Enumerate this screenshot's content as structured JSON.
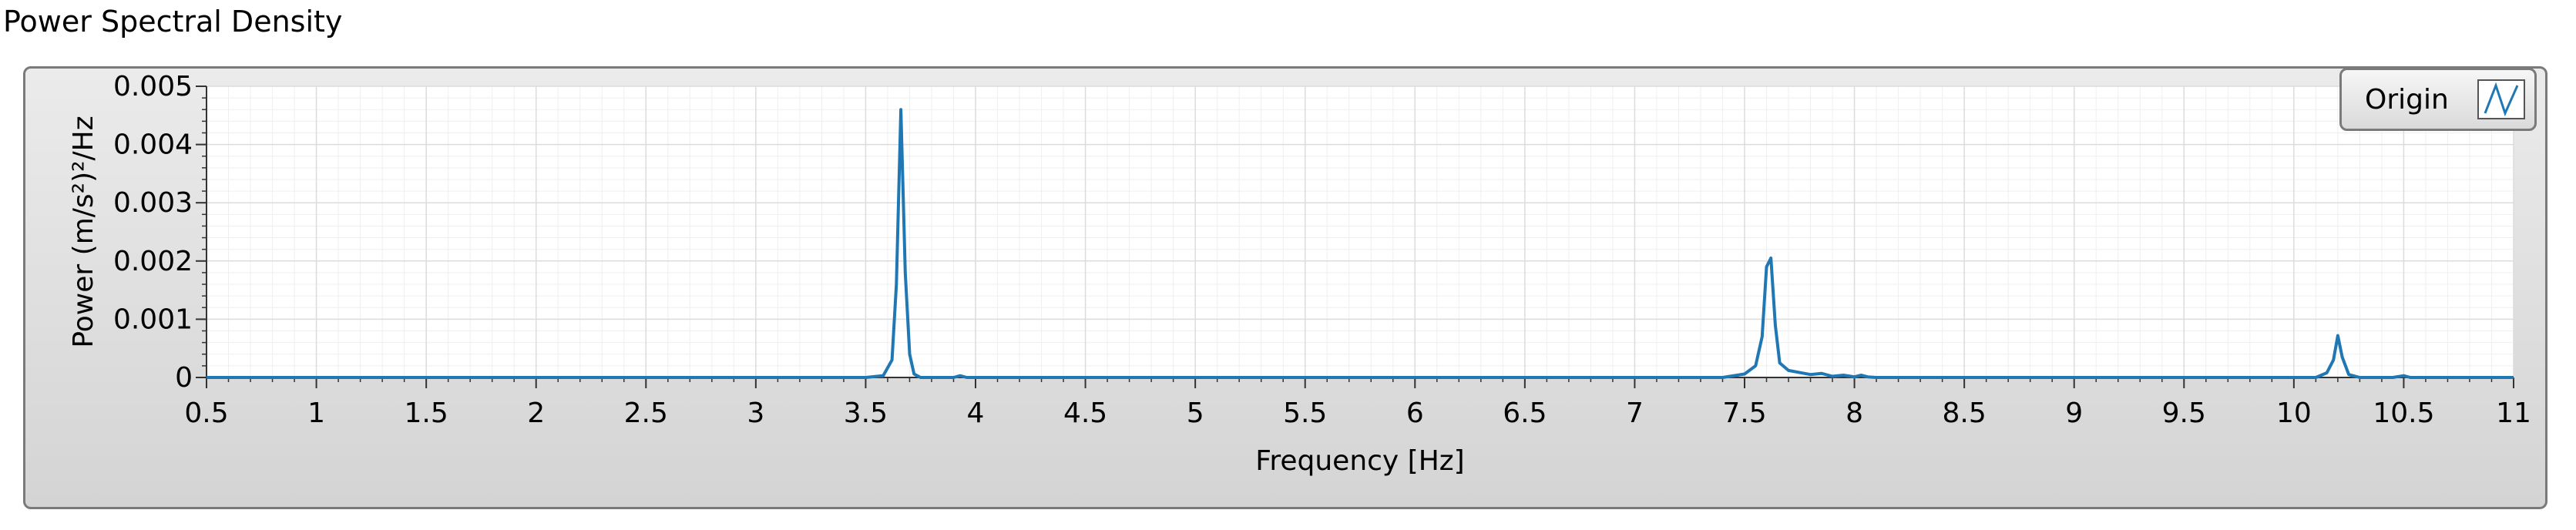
{
  "window": {
    "title": "Power Spectral Density"
  },
  "legend": {
    "entries": [
      {
        "label": "Origin",
        "color": "#1f77b4"
      }
    ]
  },
  "colors": {
    "line": "#1f77b4",
    "plot_background": "#ffffff",
    "grid_major": "#dcdcdc",
    "grid_minor": "#efefef",
    "frame": "#d9d9d9"
  },
  "chart_data": {
    "type": "line",
    "title": "",
    "xlabel": "Frequency [Hz]",
    "ylabel": "Power (m/s²)²/Hz",
    "xlim": [
      0.5,
      11
    ],
    "ylim": [
      0,
      0.005
    ],
    "xticks": [
      0.5,
      1,
      1.5,
      2,
      2.5,
      3,
      3.5,
      4,
      4.5,
      5,
      5.5,
      6,
      6.5,
      7,
      7.5,
      8,
      8.5,
      9,
      9.5,
      10,
      10.5,
      11
    ],
    "xtick_labels": [
      "0.5",
      "1",
      "1.5",
      "2",
      "2.5",
      "3",
      "3.5",
      "4",
      "4.5",
      "5",
      "5.5",
      "6",
      "6.5",
      "7",
      "7.5",
      "8",
      "8.5",
      "9",
      "9.5",
      "10",
      "10.5",
      "11"
    ],
    "yticks": [
      0,
      0.001,
      0.002,
      0.003,
      0.004,
      0.005
    ],
    "ytick_labels": [
      "0",
      "0.001",
      "0.002",
      "0.003",
      "0.004",
      "0.005"
    ],
    "grid": true,
    "legend_position": "top-right",
    "series": [
      {
        "name": "Origin",
        "x": [
          0.5,
          3.5,
          3.58,
          3.62,
          3.64,
          3.66,
          3.68,
          3.7,
          3.72,
          3.75,
          3.8,
          3.9,
          3.93,
          3.96,
          4.0,
          7.4,
          7.5,
          7.55,
          7.58,
          7.6,
          7.62,
          7.64,
          7.66,
          7.7,
          7.8,
          7.85,
          7.9,
          7.95,
          8.0,
          8.03,
          8.06,
          8.1,
          10.1,
          10.15,
          10.18,
          10.2,
          10.22,
          10.25,
          10.3,
          10.45,
          10.5,
          10.53,
          11.0
        ],
        "y": [
          0,
          0,
          3e-05,
          0.0003,
          0.0016,
          0.0046,
          0.0018,
          0.0004,
          6e-05,
          0,
          0,
          0,
          3e-05,
          0,
          0,
          0,
          6e-05,
          0.0002,
          0.0007,
          0.0019,
          0.00205,
          0.0009,
          0.00025,
          0.00012,
          5e-05,
          7e-05,
          2e-05,
          4e-05,
          1e-05,
          4e-05,
          1e-05,
          0,
          0,
          8e-05,
          0.0003,
          0.00072,
          0.00035,
          5e-05,
          0,
          0,
          3e-05,
          0,
          0
        ]
      }
    ]
  }
}
